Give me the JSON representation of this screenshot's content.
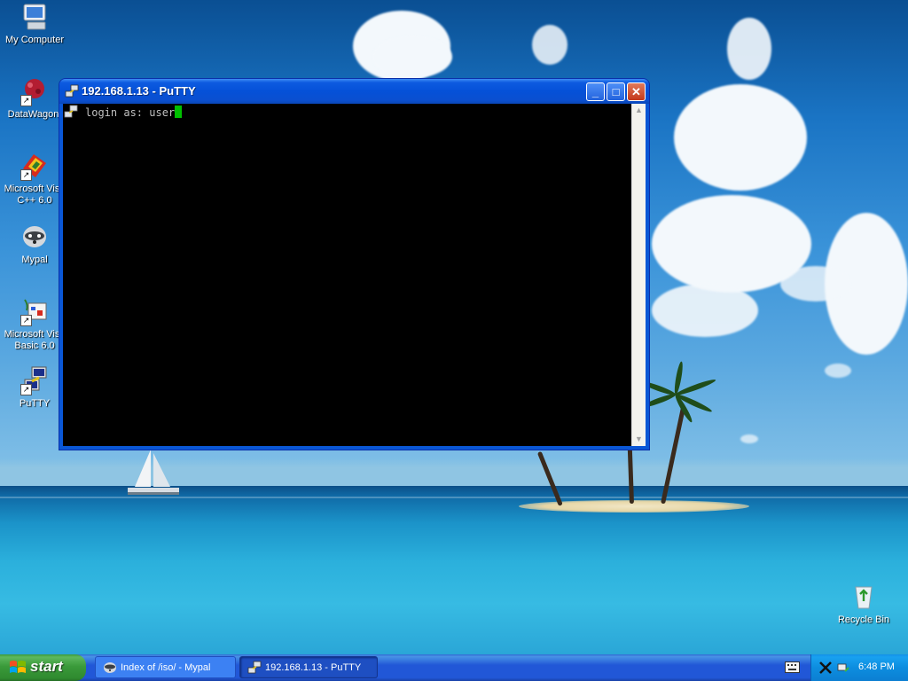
{
  "desktop": {
    "icons": [
      {
        "label": "My Computer",
        "icon": "my-computer-icon"
      },
      {
        "label": "DataWagon.",
        "icon": "datawagon-icon"
      },
      {
        "label": "Microsoft Visu C++ 6.0",
        "icon": "visual-cpp-icon"
      },
      {
        "label": "Mypal",
        "icon": "mypal-icon"
      },
      {
        "label": "Microsoft Visu Basic 6.0",
        "icon": "visual-basic-icon"
      },
      {
        "label": "PuTTY",
        "icon": "putty-icon"
      },
      {
        "label": "Recycle Bin",
        "icon": "recycle-bin-icon"
      }
    ]
  },
  "window": {
    "title": "192.168.1.13 - PuTTY",
    "minimize": "_",
    "maximize": "□",
    "close": "✕",
    "terminal": {
      "prompt": "login as: ",
      "input": "user"
    },
    "scroll_up": "▲",
    "scroll_down": "▼"
  },
  "taskbar": {
    "start_label": "start",
    "tasks": [
      {
        "label": "Index of /iso/ - Mypal",
        "icon": "mypal-icon",
        "active": false
      },
      {
        "label": "192.168.1.13 - PuTTY",
        "icon": "putty-icon",
        "active": true
      }
    ],
    "clock": "6:48 PM"
  },
  "colors": {
    "titlebar": "#0a57d6",
    "terminal_bg": "#000000",
    "terminal_fg": "#c0c0c0",
    "cursor": "#00c000",
    "start_green": "#3a9a3a",
    "tray_blue": "#0d8ddf"
  }
}
